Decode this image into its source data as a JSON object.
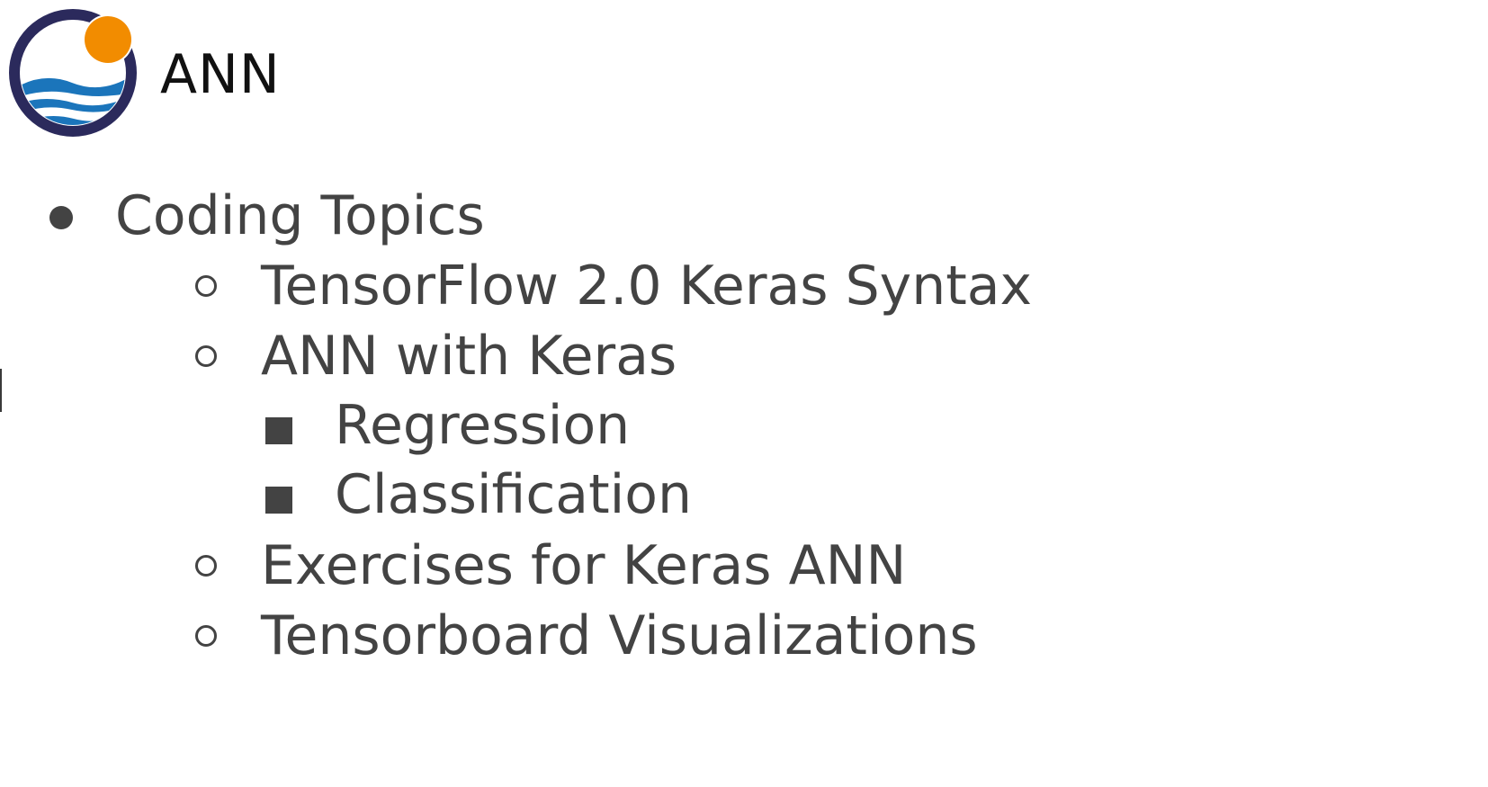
{
  "header": {
    "title": "ANN",
    "logo_icon": "sun-over-waves-logo",
    "logo_colors": {
      "ring": "#2b2a5c",
      "sun": "#f28c00",
      "waves": "#1b75bb"
    }
  },
  "outline": {
    "heading": "Coding Topics",
    "items": [
      "TensorFlow 2.0 Keras Syntax",
      "ANN with Keras",
      "Regression",
      "Classification",
      "Exercises for Keras ANN",
      "Tensorboard Visualizations"
    ]
  },
  "colors": {
    "text": "#434343",
    "title": "#111111"
  }
}
